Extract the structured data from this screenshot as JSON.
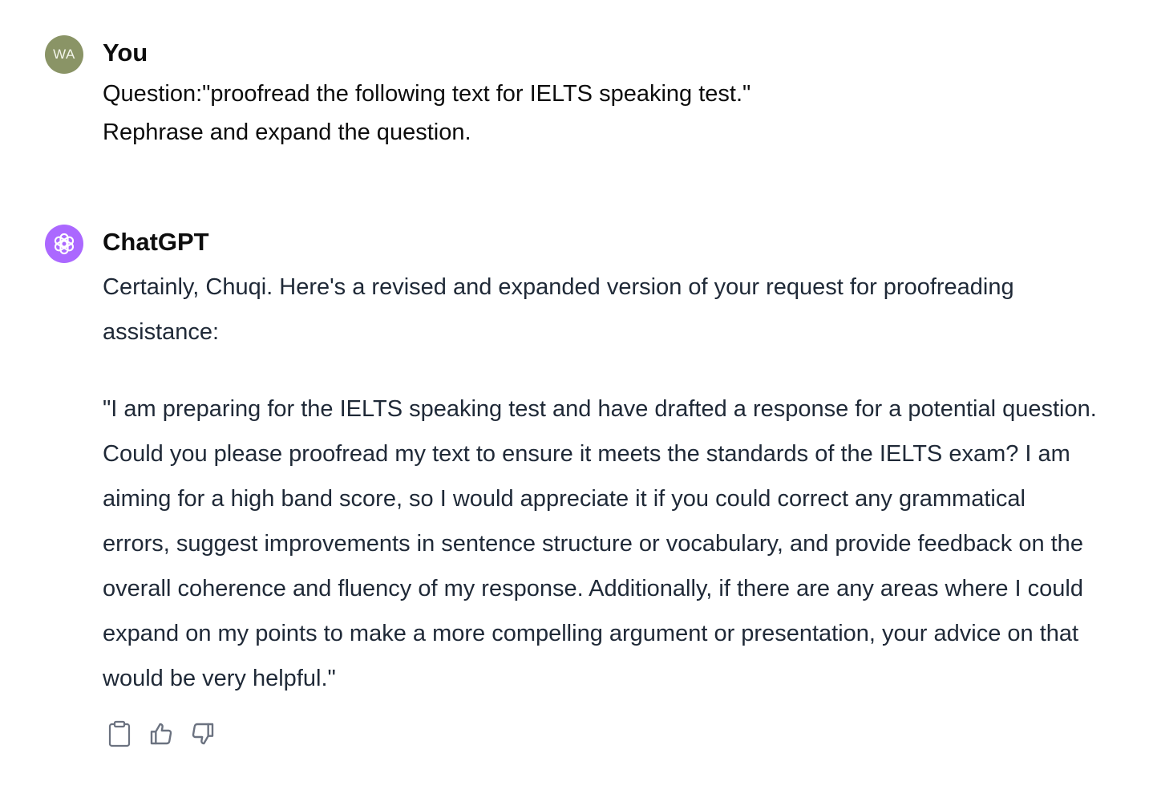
{
  "user_message": {
    "avatar_initials": "WA",
    "author": "You",
    "lines": [
      "Question:\"proofread the following text for IELTS speaking test.\"",
      "Rephrase and expand the question."
    ]
  },
  "assistant_message": {
    "avatar_icon": "openai-logo-icon",
    "author": "ChatGPT",
    "paragraphs": [
      "Certainly, Chuqi. Here's a revised and expanded version of your request for proofreading assistance:",
      "\"I am preparing for the IELTS speaking test and have drafted a response for a potential question. Could you please proofread my text to ensure it meets the standards of the IELTS exam? I am aiming for a high band score, so I would appreciate it if you could correct any grammatical errors, suggest improvements in sentence structure or vocabulary, and provide feedback on the overall coherence and fluency of my response. Additionally, if there are any areas where I could expand on my points to make a more compelling argument or presentation, your advice on that would be very helpful.\""
    ],
    "actions": [
      {
        "icon": "clipboard-icon"
      },
      {
        "icon": "thumbs-up-icon"
      },
      {
        "icon": "thumbs-down-icon"
      }
    ]
  },
  "colors": {
    "user_avatar_bg": "#8a9466",
    "assistant_avatar_bg": "#ab68ff",
    "assistant_text": "#1f2937",
    "icon_gray": "#6b7280"
  }
}
